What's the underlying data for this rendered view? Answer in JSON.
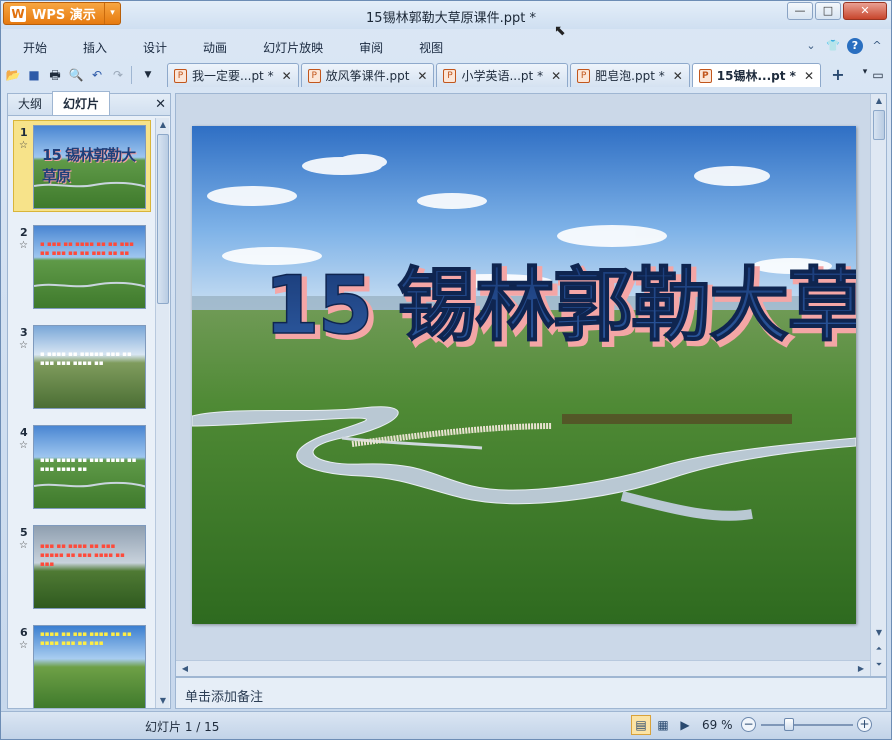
{
  "app": {
    "brand": "WPS 演示",
    "window_title": "15锡林郭勒大草原课件.ppt *"
  },
  "window_controls": {
    "minimize": "—",
    "maximize": "□",
    "close": "✕"
  },
  "menu": [
    "开始",
    "插入",
    "设计",
    "动画",
    "幻灯片放映",
    "审阅",
    "视图"
  ],
  "doc_tabs": [
    {
      "label": "我一定要...pt *",
      "active": false
    },
    {
      "label": "放风筝课件.ppt",
      "active": false
    },
    {
      "label": "小学英语...pt *",
      "active": false
    },
    {
      "label": "肥皂泡.ppt *",
      "active": false
    },
    {
      "label": "15锡林...pt *",
      "active": true
    }
  ],
  "left_panel": {
    "tabs": [
      "大纲",
      "幻灯片"
    ],
    "active_tab": "幻灯片",
    "thumbnails": [
      {
        "number": "1",
        "selected": true
      },
      {
        "number": "2",
        "selected": false
      },
      {
        "number": "3",
        "selected": false
      },
      {
        "number": "4",
        "selected": false
      },
      {
        "number": "5",
        "selected": false
      },
      {
        "number": "6",
        "selected": false
      }
    ]
  },
  "slide": {
    "title": "15 锡林郭勒大草原"
  },
  "notes_placeholder": "单击添加备注",
  "status": {
    "slide_counter": "幻灯片 1 / 15",
    "zoom": "69 %"
  },
  "icons": {
    "open": "folder-icon",
    "save": "save-icon",
    "print": "print-icon",
    "preview": "print-preview-icon",
    "undo": "undo-icon",
    "redo": "redo-icon"
  },
  "colors": {
    "brand_orange": "#e67a10",
    "title_blue": "#1e3f7a",
    "title_pink": "#f2a2a2",
    "selection_yellow": "#f7e38a"
  }
}
